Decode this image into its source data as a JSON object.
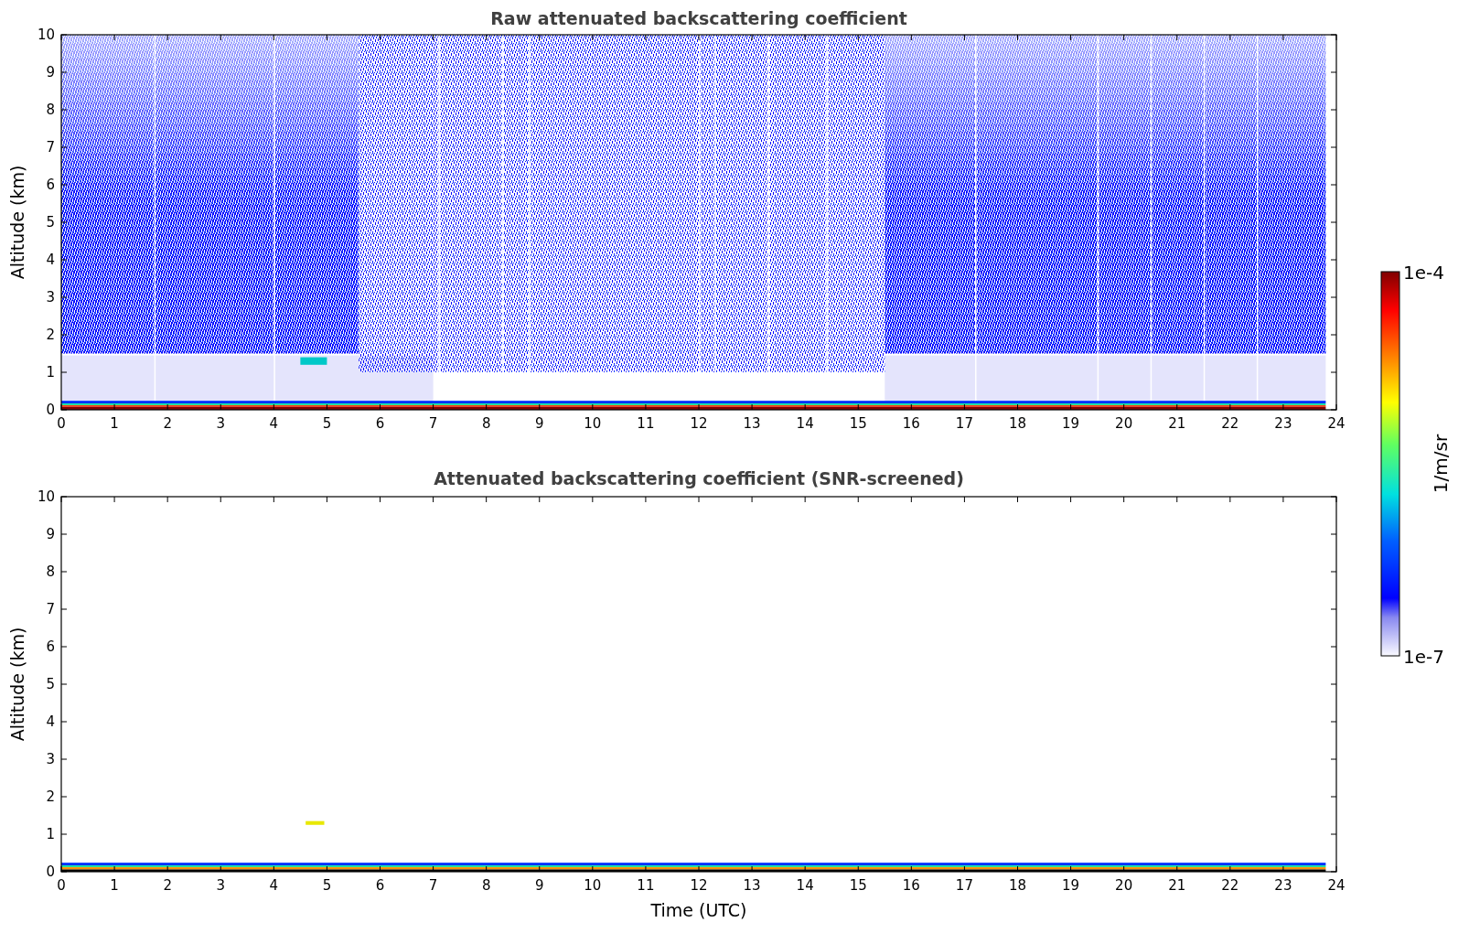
{
  "panels": [
    {
      "kind": "raw",
      "title": "Raw attenuated backscattering coefficient",
      "ylabel": "Altitude (km)",
      "yticks": [
        "10",
        "9",
        "8",
        "7",
        "6",
        "5",
        "4",
        "3",
        "2",
        "1",
        "0"
      ],
      "xticks": [
        "0",
        "1",
        "2",
        "3",
        "4",
        "5",
        "6",
        "7",
        "8",
        "9",
        "10",
        "11",
        "12",
        "13",
        "14",
        "15",
        "16",
        "17",
        "18",
        "19",
        "20",
        "21",
        "22",
        "23",
        "24"
      ]
    },
    {
      "kind": "screened",
      "title": "Attenuated backscattering coefficient (SNR-screened)",
      "ylabel": "Altitude (km)",
      "yticks": [
        "10",
        "9",
        "8",
        "7",
        "6",
        "5",
        "4",
        "3",
        "2",
        "1",
        "0"
      ],
      "xticks": [
        "0",
        "1",
        "2",
        "3",
        "4",
        "5",
        "6",
        "7",
        "8",
        "9",
        "10",
        "11",
        "12",
        "13",
        "14",
        "15",
        "16",
        "17",
        "18",
        "19",
        "20",
        "21",
        "22",
        "23",
        "24"
      ],
      "xlabel": "Time (UTC)"
    }
  ],
  "colorbar": {
    "max_label": "1e-4",
    "min_label": "1e-7",
    "unit": "1/m/sr"
  }
}
